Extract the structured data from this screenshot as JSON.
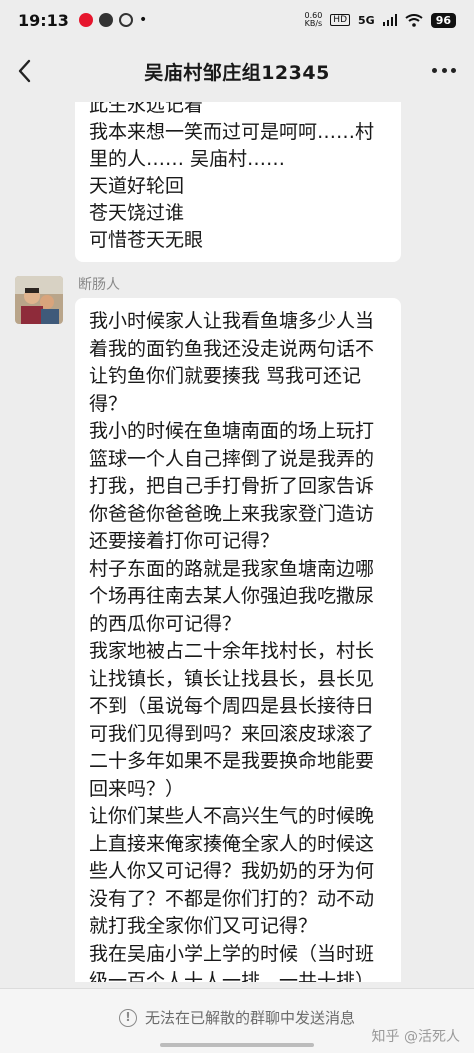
{
  "status_bar": {
    "time": "19:13",
    "net_speed_value": "0.60",
    "net_speed_unit": "KB/s",
    "signal_label": "5G",
    "battery": "96"
  },
  "nav": {
    "title": "吴庙村邹庄组12345"
  },
  "previous_message": {
    "lines": [
      "此生永远记着",
      "我本来想一笑而过可是呵呵……村",
      "里的人…… 吴庙村……",
      "天道好轮回",
      "苍天饶过谁",
      "可惜苍天无眼"
    ]
  },
  "message": {
    "sender": "断肠人",
    "lines": [
      "我小时候家人让我看鱼塘多少人当",
      "着我的面钓鱼我还没走说两句话不",
      "让钓鱼你们就要揍我 骂我可还记",
      "得？",
      "我小的时候在鱼塘南面的场上玩打",
      "篮球一个人自己摔倒了说是我弄的",
      "打我，把自己手打骨折了回家告诉",
      "你爸爸你爸爸晚上来我家登门造访",
      "还要接着打你可记得？",
      "村子东面的路就是我家鱼塘南边哪",
      "个场再往南去某人你强迫我吃撒尿",
      "的西瓜你可记得？",
      "我家地被占二十余年找村长，村长",
      "让找镇长，镇长让找县长，县长见",
      "不到（虽说每个周四是县长接待日",
      "可我们见得到吗？来回滚皮球滚了",
      "二十多年如果不是我要换命地能要",
      "回来吗？）",
      "让你们某些人不高兴生气的时候晚",
      "上直接来俺家揍俺全家人的时候这",
      "些人你又可记得？我奶奶的牙为何",
      "没有了？不都是你们打的？动不动",
      "就打我全家你们又可记得？",
      "我在吴庙小学上学的时候（当时班",
      "级一百个人十人一排，一共十排）"
    ]
  },
  "bottom": {
    "notice": "无法在已解散的群聊中发送消息",
    "watermark": "知乎 @活死人"
  },
  "icons": [
    "back-arrow-icon",
    "more-icon",
    "warning-icon"
  ],
  "colors": {
    "background": "#ededed",
    "bubble": "#ffffff",
    "text": "#191919",
    "secondary_text": "#8a8a8a"
  }
}
